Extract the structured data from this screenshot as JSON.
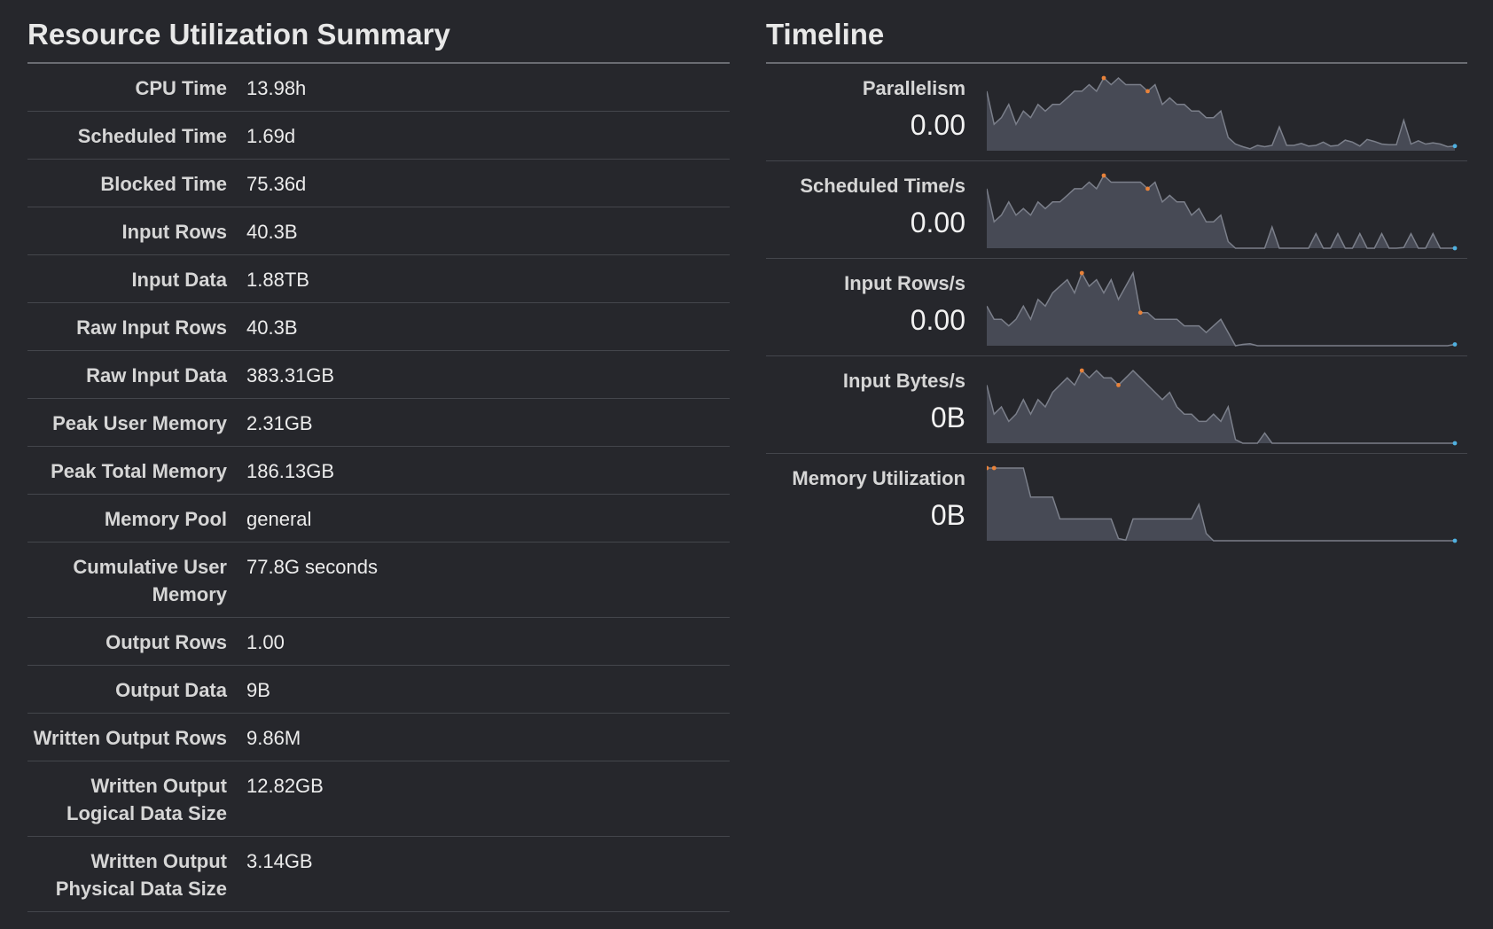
{
  "summary": {
    "title": "Resource Utilization Summary",
    "rows": [
      {
        "label": "CPU Time",
        "value": "13.98h"
      },
      {
        "label": "Scheduled Time",
        "value": "1.69d"
      },
      {
        "label": "Blocked Time",
        "value": "75.36d"
      },
      {
        "label": "Input Rows",
        "value": "40.3B"
      },
      {
        "label": "Input Data",
        "value": "1.88TB"
      },
      {
        "label": "Raw Input Rows",
        "value": "40.3B"
      },
      {
        "label": "Raw Input Data",
        "value": "383.31GB"
      },
      {
        "label": "Peak User Memory",
        "value": "2.31GB"
      },
      {
        "label": "Peak Total Memory",
        "value": "186.13GB"
      },
      {
        "label": "Memory Pool",
        "value": "general"
      },
      {
        "label": "Cumulative User Memory",
        "value": "77.8G seconds"
      },
      {
        "label": "Output Rows",
        "value": "1.00"
      },
      {
        "label": "Output Data",
        "value": "9B"
      },
      {
        "label": "Written Output Rows",
        "value": "9.86M"
      },
      {
        "label": "Written Output Logical Data Size",
        "value": "12.82GB"
      },
      {
        "label": "Written Output Physical Data Size",
        "value": "3.14GB"
      }
    ]
  },
  "timeline": {
    "title": "Timeline",
    "colors": {
      "fill": "#474a55",
      "line": "#7b7f8a",
      "max_marker": "#e8823a",
      "min_marker": "#e8823a",
      "last_marker": "#4fb0e0"
    },
    "rows": [
      {
        "label": "Parallelism",
        "value": "0.00",
        "series": [
          9,
          4,
          5,
          7,
          4,
          6,
          5,
          7,
          6,
          7,
          7,
          8,
          9,
          9,
          10,
          9,
          11,
          10,
          11,
          10,
          10,
          10,
          9,
          10,
          7,
          8,
          7,
          7,
          6,
          6,
          5,
          5,
          6,
          2,
          1,
          0.6,
          0.3,
          0.8,
          0.6,
          0.8,
          3.6,
          0.8,
          0.8,
          1.1,
          0.7,
          0.8,
          1.3,
          0.7,
          0.8,
          1.6,
          1.3,
          0.7,
          1.7,
          1.4,
          1,
          0.9,
          0.9,
          4.6,
          1,
          1.5,
          1,
          1.2,
          1,
          0.6,
          0.7
        ]
      },
      {
        "label": "Scheduled Time/s",
        "value": "0.00",
        "series": [
          9,
          4,
          5,
          7,
          5,
          6,
          5,
          7,
          6,
          7,
          7,
          8,
          9,
          9,
          10,
          9,
          11,
          10,
          10,
          10,
          10,
          10,
          9,
          10,
          7,
          8,
          7,
          7,
          5,
          6,
          4,
          4,
          5,
          1,
          0,
          0,
          0,
          0,
          0,
          3.2,
          0,
          0,
          0,
          0,
          0,
          2.2,
          0,
          0,
          2.2,
          0,
          0,
          2.2,
          0,
          0,
          2.2,
          0,
          0,
          0.1,
          2.2,
          0,
          0,
          2.2,
          0,
          0,
          0
        ]
      },
      {
        "label": "Input Rows/s",
        "value": "0.00",
        "series": [
          6,
          4,
          4,
          3,
          4,
          6,
          4,
          7,
          6,
          8,
          9,
          10,
          8,
          11,
          9,
          10,
          8,
          10,
          7,
          9,
          11,
          5,
          5,
          4,
          4,
          4,
          4,
          3,
          3,
          3,
          2,
          3,
          4,
          2,
          0,
          0.2,
          0.3,
          0,
          0,
          0,
          0,
          0,
          0,
          0,
          0,
          0,
          0,
          0,
          0,
          0,
          0,
          0,
          0,
          0,
          0,
          0,
          0,
          0,
          0,
          0,
          0,
          0,
          0,
          0,
          0.2
        ]
      },
      {
        "label": "Input Bytes/s",
        "value": "0B",
        "series": [
          8,
          4,
          5,
          3,
          4,
          6,
          4,
          6,
          5,
          7,
          8,
          9,
          8,
          10,
          9,
          10,
          9,
          9,
          8,
          9,
          10,
          9,
          8,
          7,
          6,
          7,
          5,
          4,
          4,
          3,
          3,
          4,
          3,
          5,
          0.5,
          0,
          0,
          0,
          1.4,
          0,
          0,
          0,
          0,
          0,
          0,
          0,
          0,
          0,
          0,
          0,
          0,
          0,
          0,
          0,
          0,
          0,
          0,
          0,
          0,
          0,
          0,
          0,
          0,
          0,
          0
        ]
      },
      {
        "label": "Memory Utilization",
        "value": "0B",
        "series": [
          10,
          10,
          10,
          10,
          10,
          10,
          6,
          6,
          6,
          6,
          3,
          3,
          3,
          3,
          3,
          3,
          3,
          3,
          0.3,
          0.1,
          3,
          3,
          3,
          3,
          3,
          3,
          3,
          3,
          3,
          5,
          1,
          0,
          0,
          0,
          0,
          0,
          0,
          0,
          0,
          0,
          0,
          0,
          0,
          0,
          0,
          0,
          0,
          0,
          0,
          0,
          0,
          0,
          0,
          0,
          0,
          0,
          0,
          0,
          0,
          0,
          0,
          0,
          0,
          0,
          0
        ]
      }
    ]
  }
}
